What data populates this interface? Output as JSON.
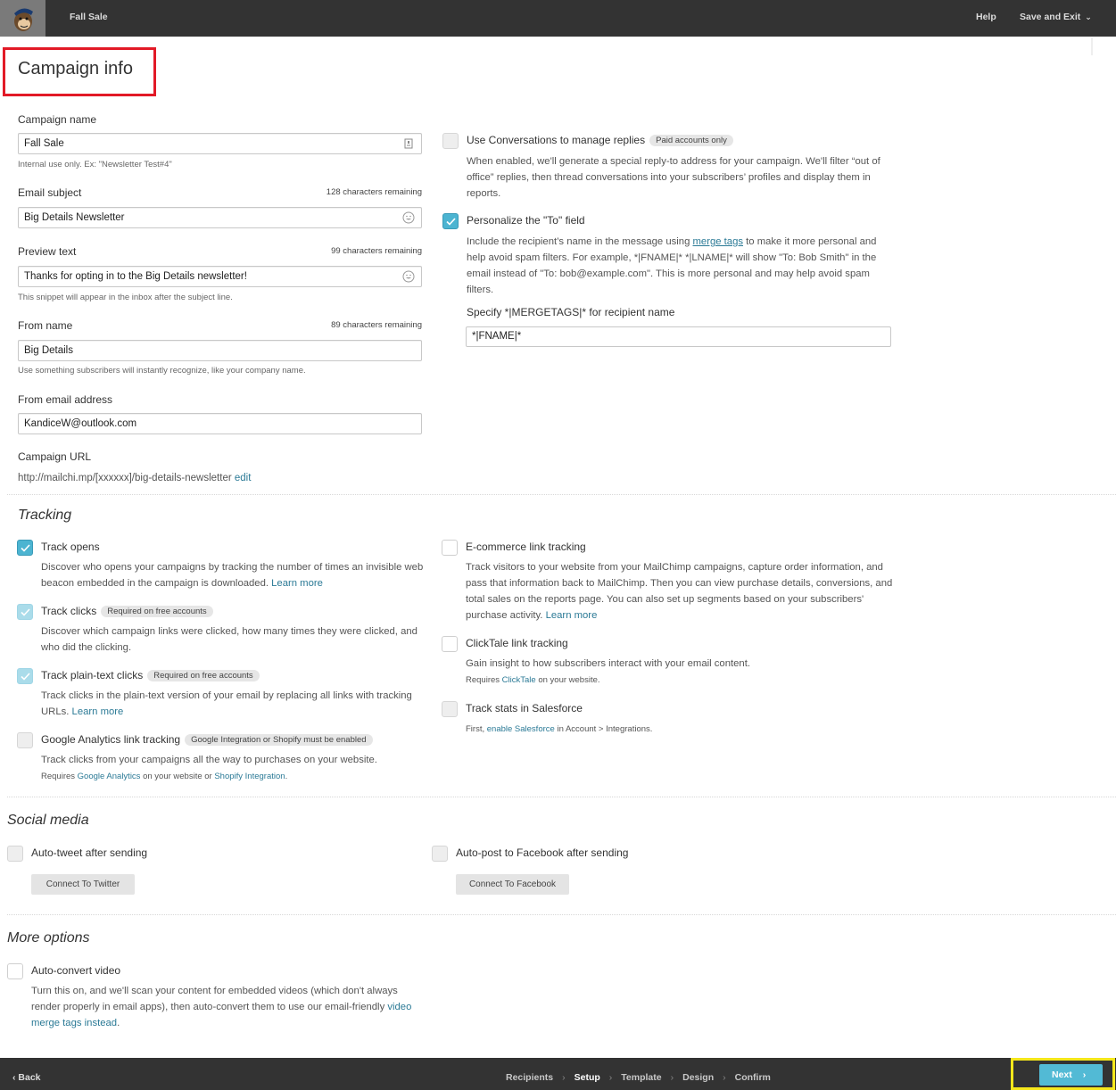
{
  "topbar": {
    "campaign_title": "Fall Sale",
    "help_label": "Help",
    "save_exit_label": "Save and Exit",
    "logo": "mailchimp-freddie-logo"
  },
  "page": {
    "title": "Campaign info",
    "accent_color": "#52bad5",
    "highlight_title_color": "#e21a27",
    "highlight_next_color": "#f5e71b"
  },
  "form": {
    "campaign_name": {
      "label": "Campaign name",
      "value": "Fall Sale",
      "hint": "Internal use only. Ex: \"Newsletter Test#4\"",
      "icon": "contact-card-icon"
    },
    "email_subject": {
      "label": "Email subject",
      "remaining": "128 characters remaining",
      "value": "Big Details Newsletter",
      "icon": "emoji-icon"
    },
    "preview_text": {
      "label": "Preview text",
      "remaining": "99 characters remaining",
      "value": "Thanks for opting in to the Big Details newsletter!",
      "hint": "This snippet will appear in the inbox after the subject line.",
      "icon": "emoji-icon"
    },
    "from_name": {
      "label": "From name",
      "remaining": "89 characters remaining",
      "value": "Big Details",
      "hint": "Use something subscribers will instantly recognize, like your company name."
    },
    "from_email": {
      "label": "From email address",
      "value": "KandiceW@outlook.com"
    },
    "campaign_url": {
      "label": "Campaign URL",
      "value": "http://mailchi.mp/[xxxxxx]/big-details-newsletter",
      "edit_label": "edit"
    }
  },
  "right_options": {
    "conversations": {
      "title": "Use Conversations to manage replies",
      "badge": "Paid accounts only",
      "checked": false,
      "desc": "When enabled, we'll generate a special reply-to address for your campaign. We'll filter “out of office” replies, then thread conversations into your subscribers’ profiles and display them in reports."
    },
    "personalize_to": {
      "title": "Personalize the \"To\" field",
      "checked": true,
      "desc_before": "Include the recipient’s name in the message using ",
      "desc_link": "merge tags",
      "desc_after": " to make it more personal and help avoid spam filters. For example, *|FNAME|* *|LNAME|* will show \"To: Bob Smith\" in the email instead of \"To: bob@example.com\". This is more personal and may help avoid spam filters.",
      "merge_label": "Specify *|MERGETAGS|* for recipient name",
      "merge_value": "*|FNAME|*"
    }
  },
  "tracking": {
    "title": "Tracking",
    "track_opens": {
      "title": "Track opens",
      "checked": true,
      "desc": "Discover who opens your campaigns by tracking the number of times an invisible web beacon embedded in the campaign is downloaded.",
      "link": "Learn more"
    },
    "track_clicks": {
      "title": "Track clicks",
      "badge": "Required on free accounts",
      "checked": true,
      "disabled": true,
      "desc": "Discover which campaign links were clicked, how many times they were clicked, and who did the clicking."
    },
    "track_plain": {
      "title": "Track plain-text clicks",
      "badge": "Required on free accounts",
      "checked": true,
      "disabled": true,
      "desc": "Track clicks in the plain-text version of your email by replacing all links with tracking URLs.",
      "link": "Learn more"
    },
    "google_analytics": {
      "title": "Google Analytics link tracking",
      "badge": "Google Integration or Shopify must be enabled",
      "checked": false,
      "desc": "Track clicks from your campaigns all the way to purchases on your website.",
      "req_before": "Requires ",
      "req_link1": "Google Analytics",
      "req_mid": " on your website or ",
      "req_link2": "Shopify Integration",
      "req_after": "."
    },
    "ecommerce": {
      "title": "E-commerce link tracking",
      "checked": false,
      "desc": "Track visitors to your website from your MailChimp campaigns, capture order information, and pass that information back to MailChimp. Then you can view purchase details, conversions, and total sales on the reports page. You can also set up segments based on your subscribers' purchase activity.",
      "link": "Learn more"
    },
    "clicktale": {
      "title": "ClickTale link tracking",
      "checked": false,
      "desc": "Gain insight to how subscribers interact with your email content.",
      "req_before": "Requires ",
      "req_link": "ClickTale",
      "req_after": " on your website."
    },
    "salesforce": {
      "title": "Track stats in Salesforce",
      "checked": false,
      "req_before": "First, ",
      "req_link": "enable Salesforce",
      "req_after": " in Account > Integrations."
    }
  },
  "social": {
    "title": "Social media",
    "twitter": {
      "title": "Auto-tweet after sending",
      "checked": false,
      "button": "Connect To Twitter"
    },
    "facebook": {
      "title": "Auto-post to Facebook after sending",
      "checked": false,
      "button": "Connect To Facebook"
    }
  },
  "more": {
    "title": "More options",
    "video": {
      "title": "Auto-convert video",
      "checked": false,
      "desc": "Turn this on, and we'll scan your content for embedded videos (which don't always render properly in email apps), then auto-convert them to use our email-friendly ",
      "link": "video merge tags instead",
      "after": "."
    }
  },
  "footer": {
    "back_label": "Back",
    "steps": [
      {
        "label": "Recipients",
        "active": false
      },
      {
        "label": "Setup",
        "active": true
      },
      {
        "label": "Template",
        "active": false
      },
      {
        "label": "Design",
        "active": false
      },
      {
        "label": "Confirm",
        "active": false
      }
    ],
    "next_label": "Next"
  }
}
